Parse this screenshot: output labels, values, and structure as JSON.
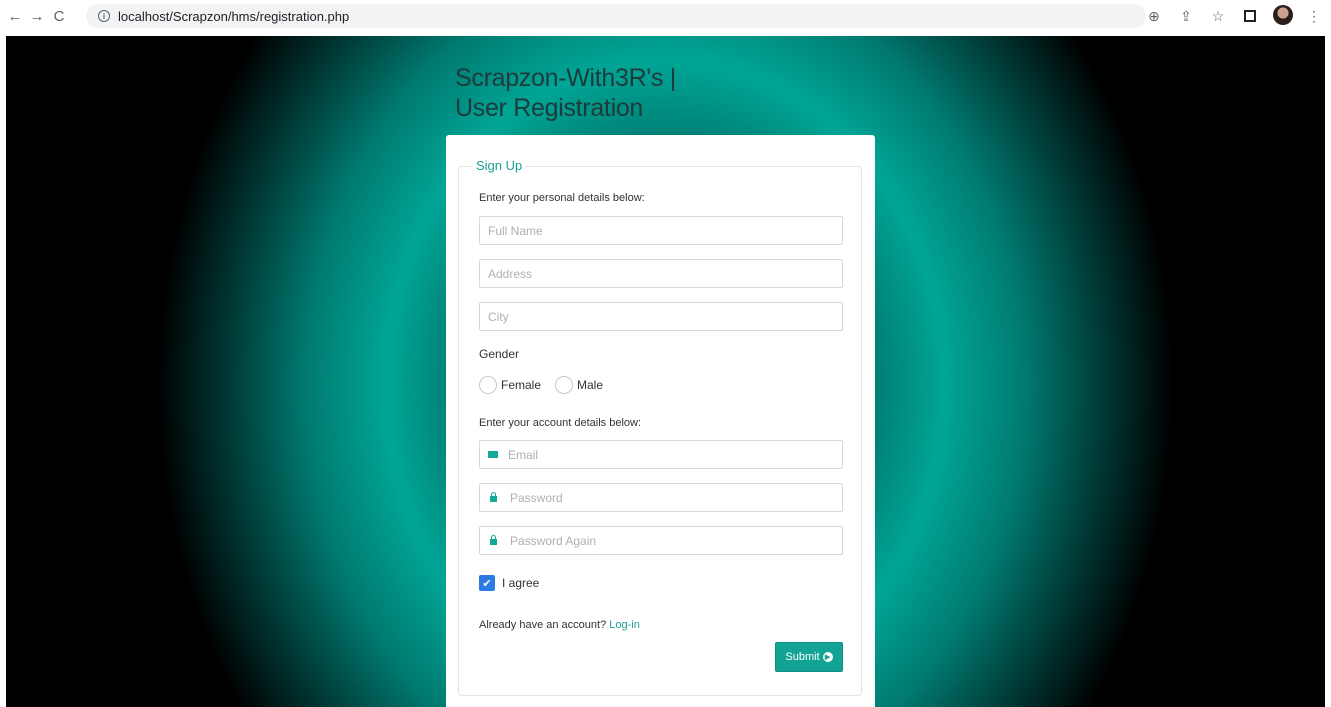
{
  "browser": {
    "back": "←",
    "forward": "→",
    "reload": "C",
    "url": "localhost/Scrapzon/hms/registration.php",
    "zoom": "⊕",
    "share": "⇪",
    "star": "☆",
    "menu": "⋮"
  },
  "page": {
    "title_line1": "Scrapzon-With3R's |",
    "title_line2": "User Registration"
  },
  "form": {
    "legend": "Sign Up",
    "personal_label": "Enter your personal details below:",
    "full_name_placeholder": "Full Name",
    "address_placeholder": "Address",
    "city_placeholder": "City",
    "gender_label": "Gender",
    "gender_female": "Female",
    "gender_male": "Male",
    "account_label": "Enter your account details below:",
    "email_placeholder": "Email",
    "password_placeholder": "Password",
    "password_again_placeholder": "Password Again",
    "agree_label": "I agree",
    "agree_checked": true,
    "already_text": "Already have an account?",
    "login_link": "Log-in",
    "submit_label": "Submit"
  },
  "colors": {
    "accent": "#13a395",
    "checkbox": "#2c7be5",
    "title": "#1e3a3a"
  }
}
